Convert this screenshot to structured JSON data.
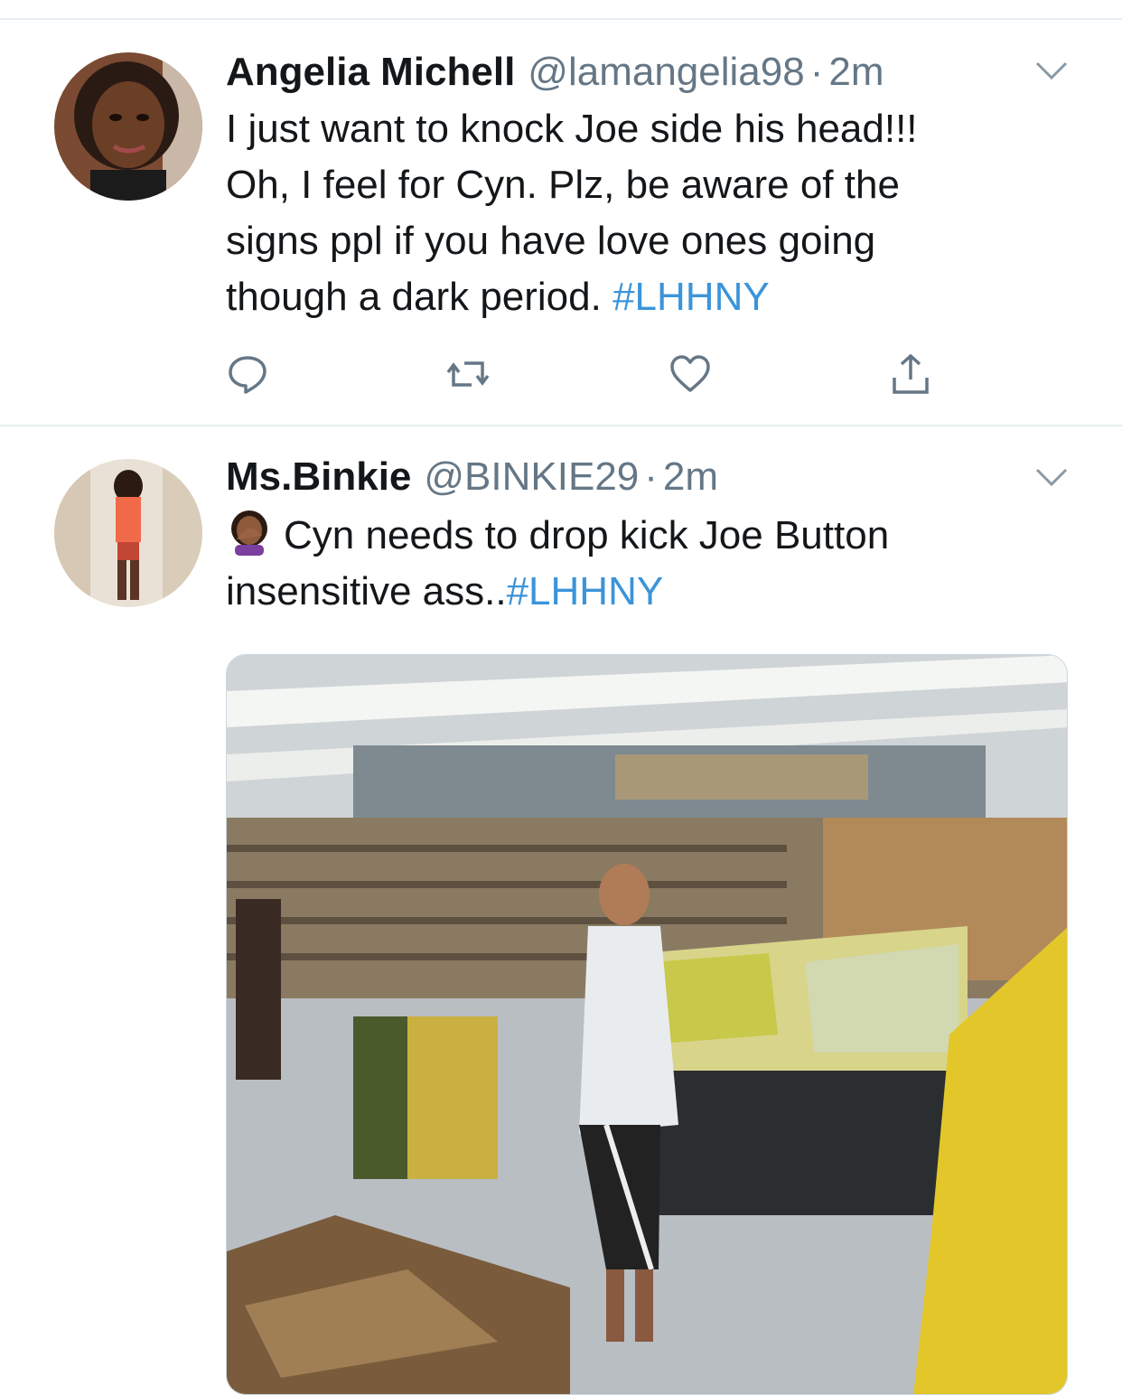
{
  "tweets": [
    {
      "display_name": "Angelia Michell",
      "handle": "@lamangelia98",
      "separator": "·",
      "time": "2m",
      "text_lines": [
        "I just want to knock Joe side his head!!!",
        "Oh, I feel for Cyn. Plz, be aware of the",
        "signs ppl if you have love ones going",
        "though a dark period. "
      ],
      "hashtag": "#LHHNY",
      "avatar_icon": "profile-photo",
      "actions": [
        "reply-icon",
        "retweet-icon",
        "like-icon",
        "share-icon"
      ]
    },
    {
      "display_name": "Ms.Binkie",
      "handle": "@BINKIE29",
      "separator": "·",
      "time": "2m",
      "emoji": "woman-facepalming-emoji",
      "text_line_1": "Cyn needs to drop kick Joe Button",
      "text_line_2": "insensitive ass..",
      "hashtag": "#LHHNY",
      "avatar_icon": "profile-photo",
      "media": "grocery-store-video-still"
    }
  ],
  "colors": {
    "hashtag": "#3b94d9",
    "secondary_text": "#657786",
    "divider": "#e6ecf0",
    "icon": "#657786"
  }
}
